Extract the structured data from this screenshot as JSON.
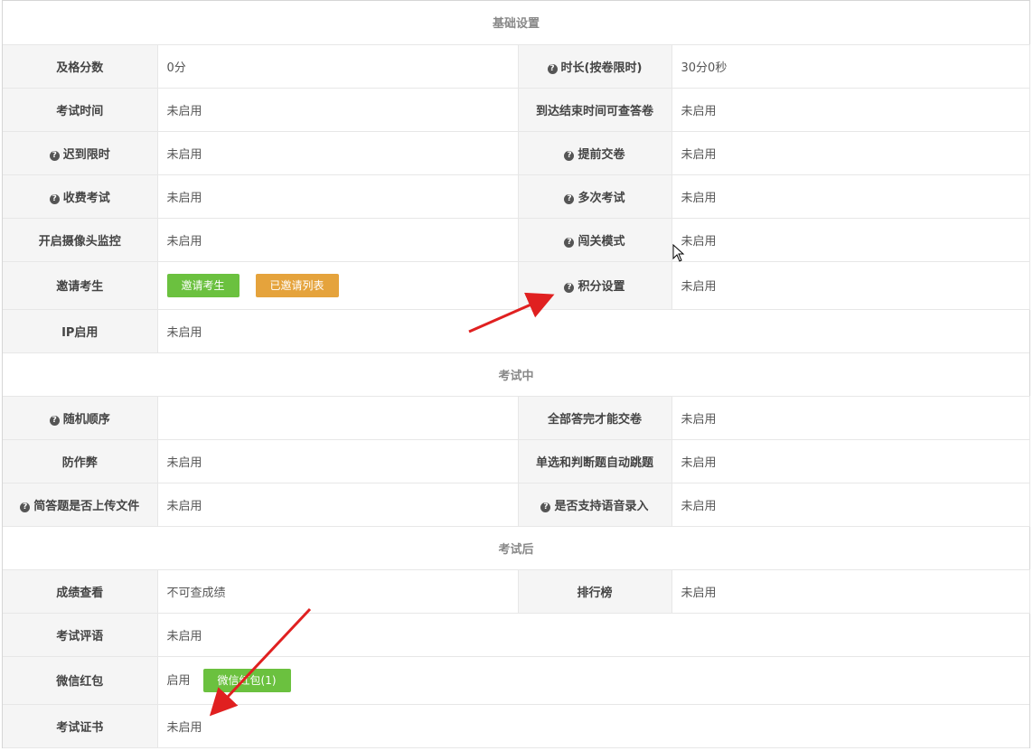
{
  "sections": {
    "basic": "基础设置",
    "during": "考试中",
    "after": "考试后"
  },
  "basic_rows": [
    {
      "l1": "及格分数",
      "v1": "0分",
      "l2": "时长(按卷限时)",
      "v2": "30分0秒"
    },
    {
      "l1": "考试时间",
      "v1": "未启用",
      "l2": "到达结束时间可查答卷",
      "v2": "未启用"
    },
    {
      "l1": "迟到限时",
      "v1": "未启用",
      "l2": "提前交卷",
      "v2": "未启用"
    },
    {
      "l1": "收费考试",
      "v1": "未启用",
      "l2": "多次考试",
      "v2": "未启用"
    },
    {
      "l1": "开启摄像头监控",
      "v1": "未启用",
      "l2": "闯关模式",
      "v2": "未启用"
    },
    {
      "l1": "邀请考生",
      "btn1": "邀请考生",
      "btn2": "已邀请列表",
      "l2": "积分设置",
      "v2": "未启用"
    },
    {
      "l1": "IP启用",
      "v1": "未启用"
    }
  ],
  "during_rows": [
    {
      "l1": "随机顺序",
      "v1": "",
      "l2": "全部答完才能交卷",
      "v2": "未启用"
    },
    {
      "l1": "防作弊",
      "v1": "未启用",
      "l2": "单选和判断题自动跳题",
      "v2": "未启用"
    },
    {
      "l1": "简答题是否上传文件",
      "v1": "未启用",
      "l2": "是否支持语音录入",
      "v2": "未启用"
    }
  ],
  "after_rows": [
    {
      "l1": "成绩查看",
      "v1": "不可查成绩",
      "l2": "排行榜",
      "v2": "未启用"
    },
    {
      "l1": "考试评语",
      "v1": "未启用"
    },
    {
      "l1": "微信红包",
      "v1": "启用",
      "btn": "微信红包(1)"
    },
    {
      "l1": "考试证书",
      "v1": "未启用"
    }
  ],
  "colors": {
    "green": "#6bc13f",
    "orange": "#e5a33c",
    "arrow": "#e02020"
  },
  "icons": [
    "question-icon",
    "cursor-icon",
    "red-arrow-annotation"
  ]
}
